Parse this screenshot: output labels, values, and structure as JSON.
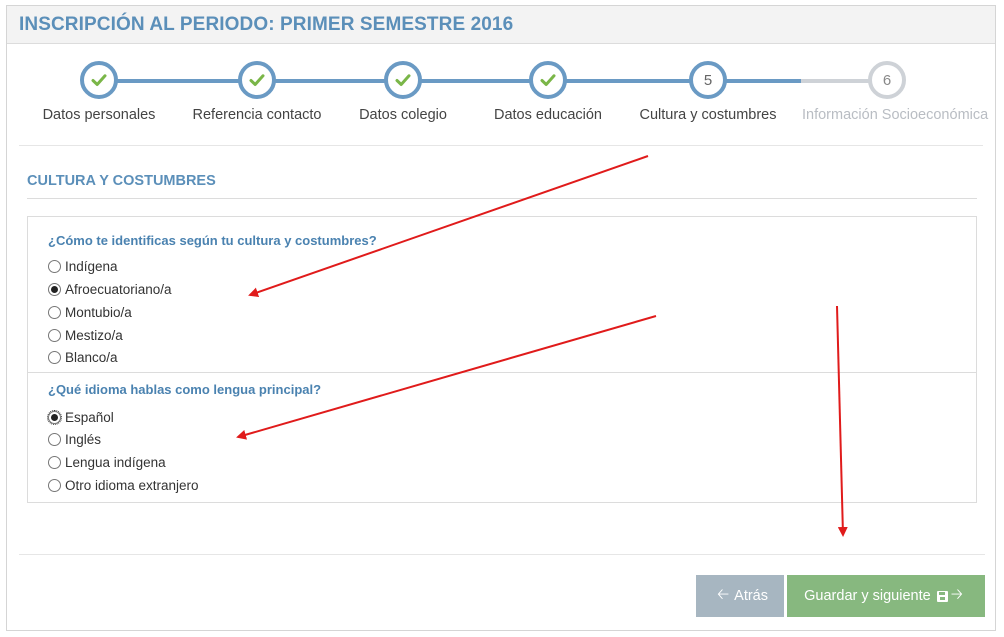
{
  "header": {
    "title": "INSCRIPCIÓN AL PERIODO: PRIMER SEMESTRE 2016"
  },
  "wizard": {
    "steps": [
      {
        "label": "Datos personales",
        "state": "done",
        "number": "1"
      },
      {
        "label": "Referencia contacto",
        "state": "done",
        "number": "2"
      },
      {
        "label": "Datos colegio",
        "state": "done",
        "number": "3"
      },
      {
        "label": "Datos educación",
        "state": "done",
        "number": "4"
      },
      {
        "label": "Cultura y costumbres",
        "state": "current",
        "number": "5"
      },
      {
        "label": "Información Socioeconómica",
        "state": "pending",
        "number": "6"
      }
    ]
  },
  "section": {
    "title": "CULTURA Y COSTUMBRES"
  },
  "questions": [
    {
      "title": "¿Cómo te identificas según tu cultura y costumbres?",
      "options": [
        "Indígena",
        "Afroecuatoriano/a",
        "Montubio/a",
        "Mestizo/a",
        "Blanco/a"
      ],
      "selected": "Afroecuatoriano/a"
    },
    {
      "title": "¿Qué idioma hablas como lengua principal?",
      "options": [
        "Español",
        "Inglés",
        "Lengua indígena",
        "Otro idioma extranjero"
      ],
      "selected": "Español"
    }
  ],
  "buttons": {
    "back": "Atrás",
    "save": "Guardar y siguiente"
  },
  "icons": {
    "done_step": "check-icon",
    "back": "arrow-left-icon",
    "save": "floppy-disk-icon",
    "next": "arrow-right-icon"
  },
  "colors": {
    "accent": "#5b8fb9",
    "step_line": "#6a9ac4",
    "check": "#7ab648",
    "pending": "#ced2d7",
    "back_button": "#a7b6c1",
    "save_button": "#87b87f",
    "annotation_arrow": "#e01b1b"
  }
}
